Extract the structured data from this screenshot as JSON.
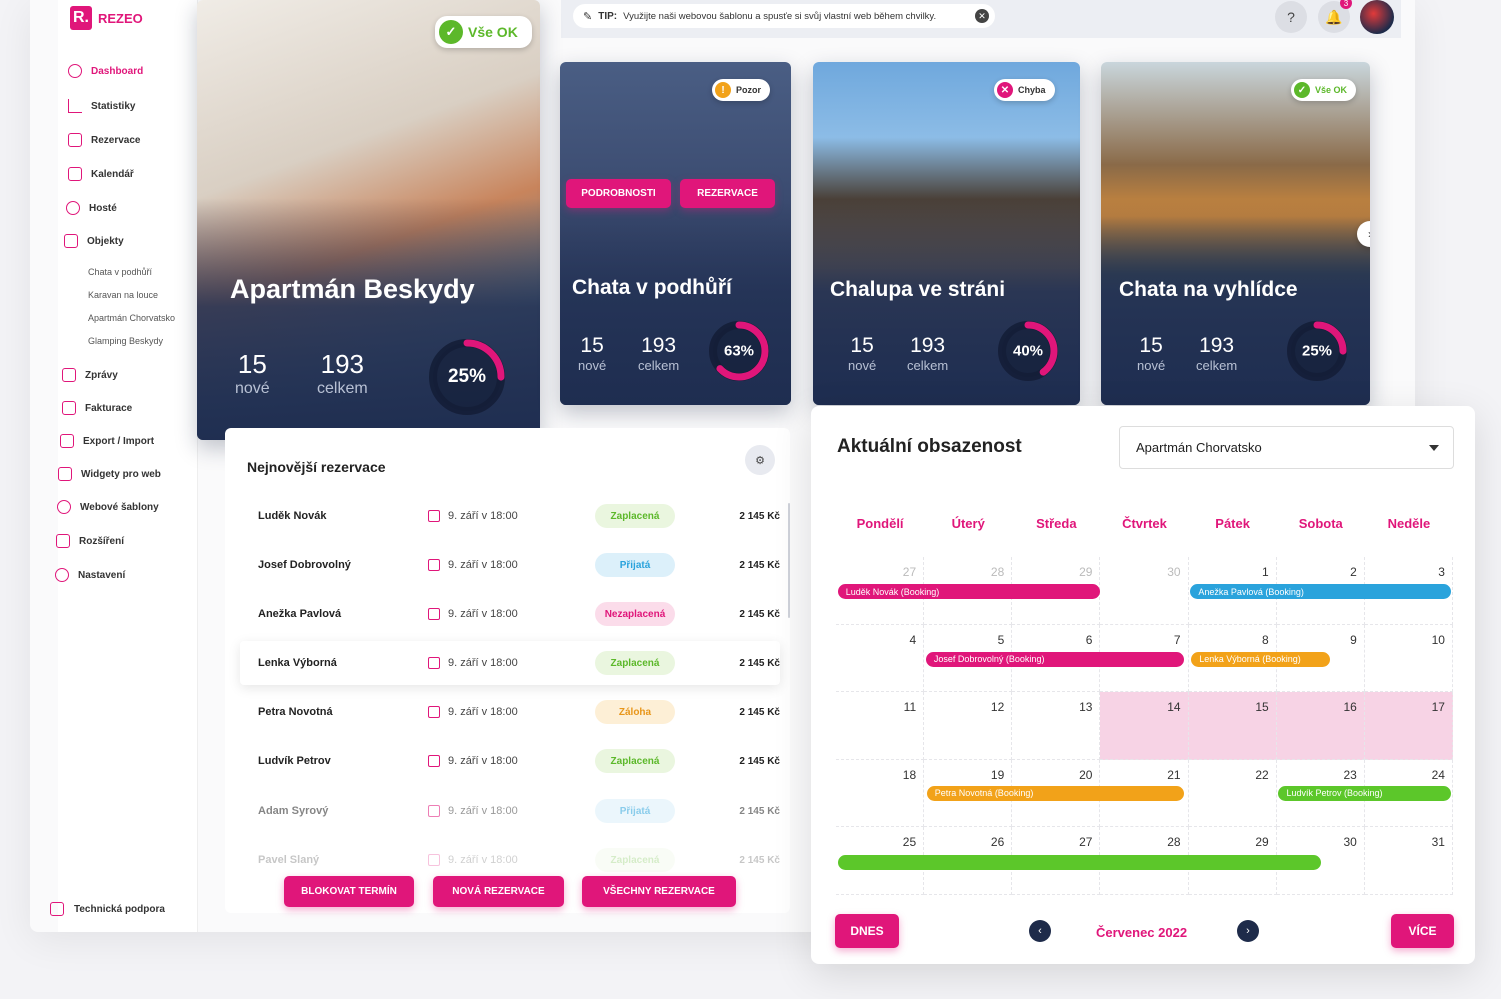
{
  "brand": {
    "mark": "R.",
    "name": "REZEO",
    "accent": "#e0167a"
  },
  "tip": {
    "label": "TIP:",
    "text": "Využijte naši webovou šablonu a spusťe si svůj vlastní web během chvilky."
  },
  "topbar": {
    "help": "?",
    "notifications": "3"
  },
  "sidebar": {
    "items": [
      {
        "label": "Dashboard"
      },
      {
        "label": "Statistiky"
      },
      {
        "label": "Rezervace"
      },
      {
        "label": "Kalendář"
      },
      {
        "label": "Hosté"
      },
      {
        "label": "Objekty"
      },
      {
        "label": "Zprávy"
      },
      {
        "label": "Fakturace"
      },
      {
        "label": "Export / Import"
      },
      {
        "label": "Widgety pro web"
      },
      {
        "label": "Webové šablony"
      },
      {
        "label": "Rozšíření"
      },
      {
        "label": "Nastavení"
      }
    ],
    "objects": [
      "Chata v podhůří",
      "Karavan na louce",
      "Apartmán Chorvatsko",
      "Glamping Beskydy"
    ],
    "support": "Technická podpora"
  },
  "properties": [
    {
      "name": "Apartmán Beskydy",
      "badge": "Vše OK",
      "new": "15",
      "new_label": "nové",
      "total": "193",
      "total_label": "celkem",
      "occupancy": 25,
      "pct": "25%"
    },
    {
      "name": "Chata v podhůří",
      "badge": "Pozor",
      "new": "15",
      "new_label": "nové",
      "total": "193",
      "total_label": "celkem",
      "occupancy": 63,
      "pct": "63%",
      "detail_btn": "PODROBNOSTI",
      "res_btn": "REZERVACE"
    },
    {
      "name": "Chalupa ve stráni",
      "badge": "Chyba",
      "new": "15",
      "new_label": "nové",
      "total": "193",
      "total_label": "celkem",
      "occupancy": 40,
      "pct": "40%"
    },
    {
      "name": "Chata na vyhlídce",
      "badge": "Vše OK",
      "new": "15",
      "new_label": "nové",
      "total": "193",
      "total_label": "celkem",
      "occupancy": 25,
      "pct": "25%"
    }
  ],
  "reservations": {
    "title": "Nejnovější rezervace",
    "rows": [
      {
        "name": "Luděk Novák",
        "date": "9. září v 18:00",
        "status": "Zaplacená",
        "amount": "2 145 Kč"
      },
      {
        "name": "Josef Dobrovolný",
        "date": "9. září v 18:00",
        "status": "Přijatá",
        "amount": "2 145 Kč"
      },
      {
        "name": "Anežka Pavlová",
        "date": "9. září v 18:00",
        "status": "Nezaplacená",
        "amount": "2 145 Kč"
      },
      {
        "name": "Lenka Výborná",
        "date": "9. září v 18:00",
        "status": "Zaplacená",
        "amount": "2 145 Kč"
      },
      {
        "name": "Petra Novotná",
        "date": "9. září v 18:00",
        "status": "Záloha",
        "amount": "2 145 Kč"
      },
      {
        "name": "Ludvík Petrov",
        "date": "9. září v 18:00",
        "status": "Zaplacená",
        "amount": "2 145 Kč"
      },
      {
        "name": "Adam Syrový",
        "date": "9. září v 18:00",
        "status": "Přijatá",
        "amount": "2 145 Kč"
      },
      {
        "name": "Pavel Slaný",
        "date": "9. září v 18:00",
        "status": "Zaplacená",
        "amount": "2 145 Kč"
      }
    ],
    "buttons": {
      "block": "BLOKOVAT TERMÍN",
      "new": "NOVÁ REZERVACE",
      "all": "VŠECHNY REZERVACE"
    }
  },
  "occupancy": {
    "title": "Aktuální obsazenost",
    "selected_property": "Apartmán Chorvatsko",
    "weekdays": [
      "Pondělí",
      "Úterý",
      "Středa",
      "Čtvrtek",
      "Pátek",
      "Sobota",
      "Neděle"
    ],
    "weeks": [
      [
        "27",
        "28",
        "29",
        "30",
        "1",
        "2",
        "3"
      ],
      [
        "4",
        "5",
        "6",
        "7",
        "8",
        "9",
        "10"
      ],
      [
        "11",
        "12",
        "13",
        "14",
        "15",
        "16",
        "17"
      ],
      [
        "18",
        "19",
        "20",
        "21",
        "22",
        "23",
        "24"
      ],
      [
        "25",
        "26",
        "27",
        "28",
        "29",
        "30",
        "31"
      ]
    ],
    "events": [
      {
        "label": "Luděk Novák (Booking)",
        "color": "#e0167a"
      },
      {
        "label": "Anežka Pavlová (Booking)",
        "color": "#2aa3dc"
      },
      {
        "label": "Josef Dobrovolný (Booking)",
        "color": "#e0167a"
      },
      {
        "label": "Lenka Výborná (Booking)",
        "color": "#f2a219"
      },
      {
        "label": "Petra Novotná (Booking)",
        "color": "#f2a219"
      },
      {
        "label": "Ludvík Petrov (Booking)",
        "color": "#5cc72a"
      },
      {
        "label": "",
        "color": "#5cc72a"
      }
    ],
    "today_btn": "DNES",
    "month": "Červenec 2022",
    "more_btn": "VÍCE"
  },
  "status_colors": {
    "Zaplacená": [
      "#eaf6df",
      "#5cb82a"
    ],
    "Přijatá": [
      "#dcf0fa",
      "#2aa3dc"
    ],
    "Nezaplacená": [
      "#fbdcea",
      "#e0167a"
    ],
    "Záloha": [
      "#fdefd6",
      "#e8961a"
    ]
  }
}
